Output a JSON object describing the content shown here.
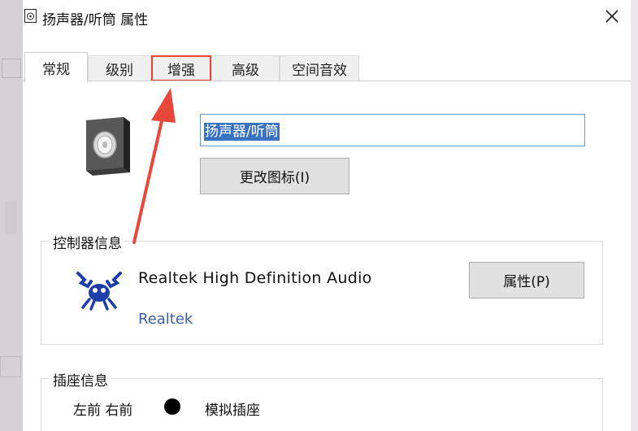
{
  "window": {
    "title": "扬声器/听筒 属性",
    "close_symbol": "✕"
  },
  "tabs": [
    {
      "label": "常规",
      "active": true
    },
    {
      "label": "级别",
      "active": false
    },
    {
      "label": "增强",
      "active": false,
      "highlighted": true
    },
    {
      "label": "高级",
      "active": false
    },
    {
      "label": "空间音效",
      "active": false
    }
  ],
  "general": {
    "device_name_value": "扬声器/听筒",
    "change_icon_label": "更改图标(I)"
  },
  "controller": {
    "group_label": "控制器信息",
    "device_name": "Realtek High Definition Audio",
    "vendor": "Realtek",
    "properties_label": "属性(P)"
  },
  "jack": {
    "group_label": "插座信息",
    "position": "左前 右前",
    "type": "模拟插座"
  },
  "colors": {
    "annotation_red": "#e8483c",
    "selection_blue": "#3a72c2",
    "vendor_link": "#3a5fa8"
  },
  "icons": {
    "title": "speaker-icon",
    "device": "speaker-icon",
    "controller": "realtek-crab-icon",
    "close": "close-icon"
  }
}
